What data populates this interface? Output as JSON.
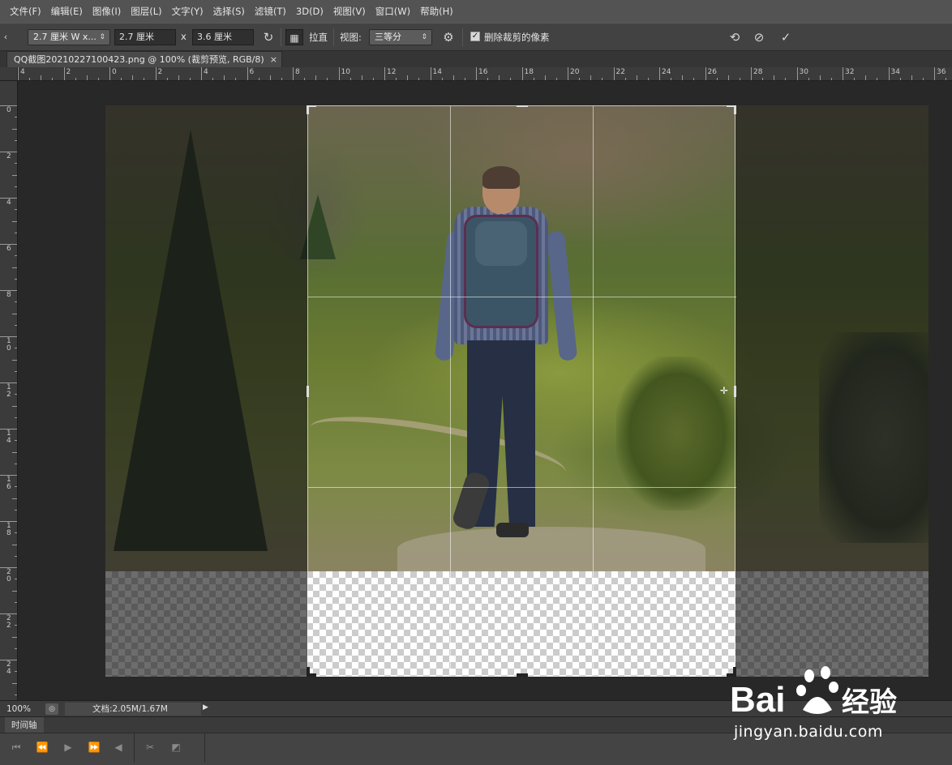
{
  "menu": [
    "文件(F)",
    "编辑(E)",
    "图像(I)",
    "图层(L)",
    "文字(Y)",
    "选择(S)",
    "滤镜(T)",
    "3D(D)",
    "视图(V)",
    "窗口(W)",
    "帮助(H)"
  ],
  "options": {
    "ratio_select": "2.7 厘米  W x...",
    "width_value": "2.7 厘米",
    "x_sep": "x",
    "height_value": "3.6 厘米",
    "straighten_label": "拉直",
    "view_label": "视图:",
    "view_select": "三等分",
    "delete_pixels_label": "删除裁剪的像素",
    "delete_pixels_checked": true
  },
  "document_tab": {
    "title": "QQ截图20210227100423.png @ 100% (裁剪预览, RGB/8)",
    "close": "×"
  },
  "ruler_top_labels": [
    "4",
    "2",
    "0",
    "2",
    "4",
    "6",
    "8",
    "10",
    "12",
    "14",
    "16",
    "18",
    "20",
    "22",
    "24",
    "26",
    "28",
    "30",
    "32",
    "34",
    "36"
  ],
  "ruler_left_labels": [
    "0",
    "2",
    "4",
    "6",
    "8",
    "1\n0",
    "1\n2",
    "1\n4",
    "1\n6",
    "1\n8",
    "2\n0",
    "2\n2",
    "2\n4"
  ],
  "status": {
    "zoom": "100%",
    "doc_info": "文档:2.05M/1.67M"
  },
  "timeline": {
    "label": "时间轴"
  },
  "watermark": {
    "brand": "Bai",
    "brand_suffix": "经验",
    "url": "jingyan.baidu.com"
  },
  "colors": {
    "menu_bg": "#535353",
    "panel_bg": "#424242",
    "canvas_bg": "#282828"
  },
  "icons": [
    "rotate-icon",
    "straighten-icon",
    "gear-icon",
    "reset-icon",
    "cancel-icon",
    "commit-icon",
    "scissors-icon",
    "transition-icon",
    "play-icon"
  ]
}
